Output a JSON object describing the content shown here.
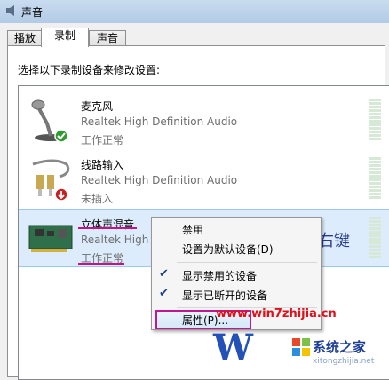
{
  "window": {
    "title": "声音"
  },
  "tabs": [
    {
      "label": "播放"
    },
    {
      "label": "录制"
    },
    {
      "label": "声音"
    }
  ],
  "prompt": "选择以下录制设备来修改设置:",
  "devices": [
    {
      "name": "麦克风",
      "driver": "Realtek High Definition Audio",
      "status": "工作正常",
      "icon": "microphone-icon",
      "badge": "green-check-badge"
    },
    {
      "name": "线路输入",
      "driver": "Realtek High Definition Audio",
      "status": "未插入",
      "icon": "line-in-cable-icon",
      "badge": "red-unplugged-badge"
    },
    {
      "name": "立体声混音",
      "driver": "Realtek High",
      "status": "工作正常",
      "icon": "sound-card-icon"
    }
  ],
  "annotation": {
    "right_click_text": "右键",
    "underline_color": "#c0148c"
  },
  "context_menu": {
    "items": [
      {
        "label": "禁用",
        "checked": false
      },
      {
        "label": "设置为默认设备(D)",
        "checked": false
      },
      {
        "label": "显示禁用的设备",
        "checked": true
      },
      {
        "label": "显示已断开的设备",
        "checked": true
      },
      {
        "label": "属性(P)...",
        "checked": false,
        "highlighted": true
      }
    ]
  },
  "watermark": {
    "site1": "www.win7zhijia.cn",
    "brand": "系统之家",
    "site2": "xitongzhijia.net",
    "logo_text": "W"
  },
  "colors": {
    "accent": "#c0148c",
    "selection": "#dcecfc",
    "meter": "#d6e8d6"
  }
}
